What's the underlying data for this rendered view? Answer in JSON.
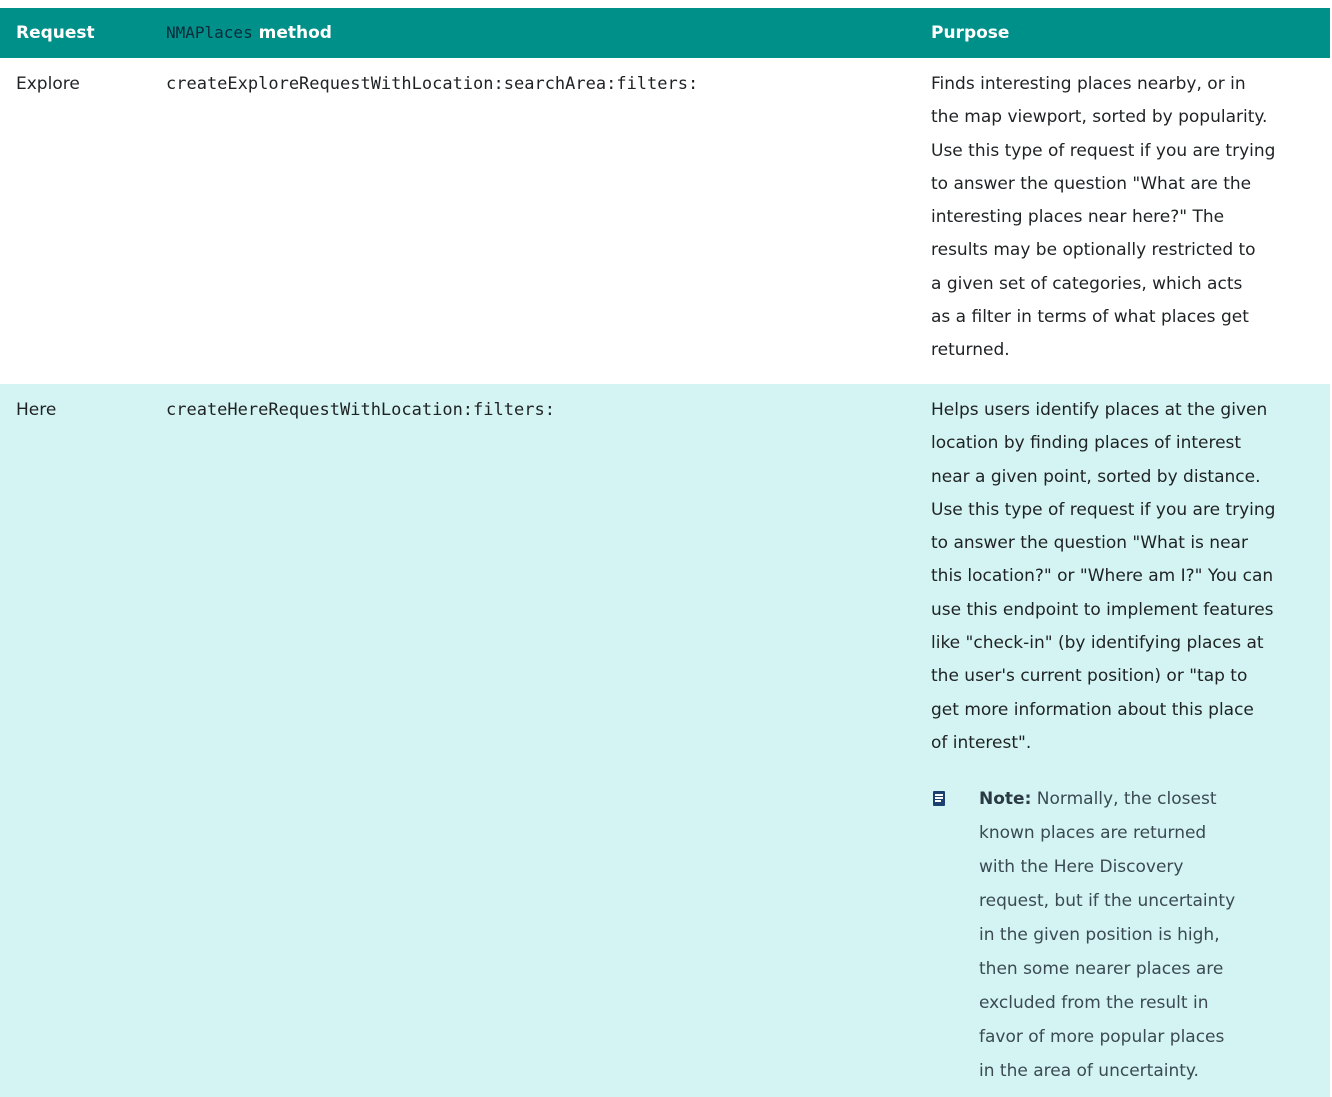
{
  "table": {
    "headers": {
      "request": "Request",
      "method_code": "NMAPlaces",
      "method_suffix": " method",
      "purpose": "Purpose"
    },
    "rows": [
      {
        "request": "Explore",
        "method": "createExploreRequestWithLocation:searchArea:filters:",
        "purpose_lines": [
          "Finds interesting places nearby, or in",
          "the map viewport, sorted by popularity.",
          "Use this type of request if you are trying",
          "to answer the question \"What are the",
          "interesting places near here?\" The",
          "results may be optionally restricted to",
          "a given set of categories, which acts",
          "as a filter in terms of what places get",
          "returned."
        ]
      },
      {
        "request": "Here",
        "method": "createHereRequestWithLocation:filters:",
        "purpose_lines": [
          "Helps users identify places at the given",
          "location by finding places of interest",
          "near a given point, sorted by distance.",
          "Use this type of request if you are trying",
          "to answer the question \"What is near",
          "this location?\" or \"Where am I?\" You can",
          "use this endpoint to implement features",
          "like \"check-in\" (by identifying places at",
          "the user's current position) or \"tap to",
          "get more information about this place",
          "of interest\"."
        ],
        "note": {
          "icon": "note-icon",
          "label": "Note:",
          "lines": [
            " Normally, the closest",
            "known places are returned",
            "with the Here Discovery",
            "request, but if the uncertainty",
            "in the given position is high,",
            "then some nearer places are",
            "excluded from the result in",
            "favor of more popular places",
            "in the area of uncertainty."
          ]
        }
      }
    ]
  },
  "colors": {
    "header_bg": "#00908a",
    "row_alt_bg": "#d3f4f2",
    "note_icon": "#1b3f6e"
  }
}
